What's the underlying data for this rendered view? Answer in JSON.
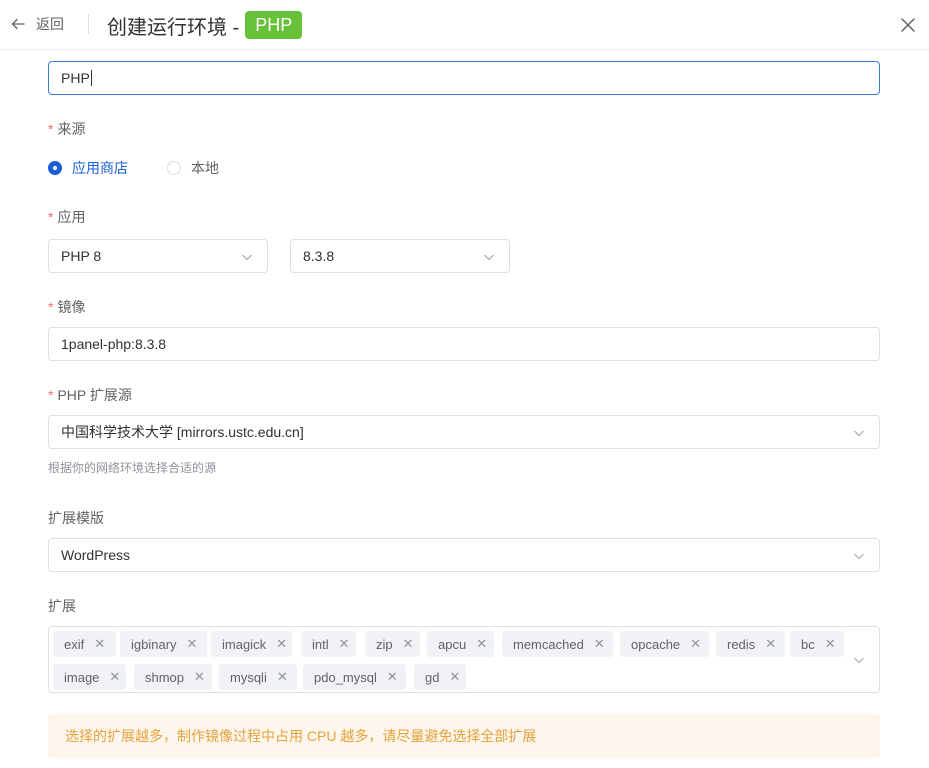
{
  "header": {
    "back_label": "返回",
    "title": "创建运行环境 -",
    "tag": "PHP"
  },
  "name_field": {
    "value": "PHP"
  },
  "source": {
    "label": "来源",
    "options": [
      {
        "label": "应用商店",
        "checked": true
      },
      {
        "label": "本地",
        "checked": false
      }
    ]
  },
  "app": {
    "label": "应用",
    "app_value": "PHP 8",
    "version_value": "8.3.8"
  },
  "image": {
    "label": "镜像",
    "value": "1panel-php:8.3.8"
  },
  "ext_source": {
    "label": "PHP 扩展源",
    "value": "中国科学技术大学 [mirrors.ustc.edu.cn]",
    "help": "根据你的网络环境选择合适的源"
  },
  "ext_template": {
    "label": "扩展模版",
    "value": "WordPress"
  },
  "extensions": {
    "label": "扩展",
    "row1": [
      "exif",
      "igbinary",
      "imagick",
      "intl",
      "zip",
      "apcu",
      "memcached",
      "opcache",
      "redis",
      "bc"
    ],
    "row2": [
      "image",
      "shmop",
      "mysqli",
      "pdo_mysql",
      "gd"
    ]
  },
  "alert": {
    "text": "选择的扩展越多，制作镜像过程中占用 CPU 越多，请尽量避免选择全部扩展"
  },
  "colors": {
    "primary": "#1a5fd6",
    "tag_green": "#67c23a",
    "warning": "#e6a23c",
    "required": "#f56c6c"
  }
}
